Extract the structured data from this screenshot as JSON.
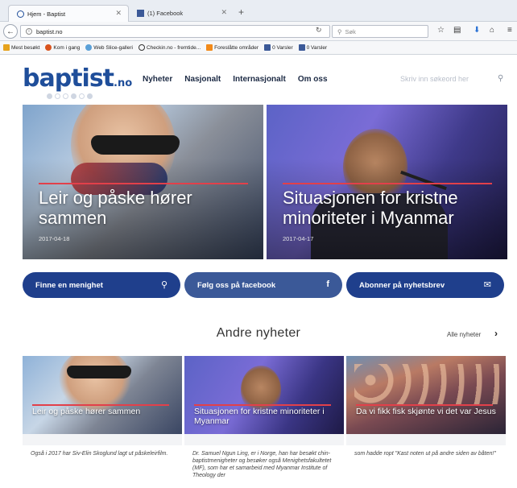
{
  "browser": {
    "tabs": [
      {
        "label": "Hjem - Baptist",
        "active": true
      },
      {
        "label": "(1) Facebook",
        "active": false
      }
    ],
    "new_tab": "+",
    "url": "baptist.no",
    "search_placeholder": "Søk",
    "bookmarks": [
      {
        "label": "Mest besøkt",
        "color": "#e6a21c"
      },
      {
        "label": "Kom i gang",
        "color": "#d9531e"
      },
      {
        "label": "Web Slice-galleri",
        "color": "#5aa0d8"
      },
      {
        "label": "Checkin.no - fremtide...",
        "color": "#333333"
      },
      {
        "label": "Foreslåtte områder",
        "color": "#f28a1a"
      },
      {
        "label": "0 Varsler",
        "color": "#3b5998"
      },
      {
        "label": "0 Varsler",
        "color": "#3b5998"
      }
    ]
  },
  "site": {
    "logo": {
      "main": "baptist",
      "suffix": ".no"
    },
    "nav": [
      "Nyheter",
      "Nasjonalt",
      "Internasjonalt",
      "Om oss"
    ],
    "search_placeholder": "Skriv inn søkeord her",
    "hero": [
      {
        "title": "Leir og påske hører sammen",
        "date": "2017-04-18"
      },
      {
        "title": "Situasjonen for kristne minoriteter i Myanmar",
        "date": "2017-04-17"
      }
    ],
    "actions": [
      {
        "label": "Finne en menighet",
        "icon": "search-icon"
      },
      {
        "label": "Følg oss på facebook",
        "icon": "facebook-icon"
      },
      {
        "label": "Abonner på nyhetsbrev",
        "icon": "mail-icon"
      }
    ],
    "section_title": "Andre nyheter",
    "all_news": "Alle nyheter",
    "cards": [
      {
        "title": "Leir og påske hører sammen",
        "body": "Også i 2017 har Siv-Elin Skoglund lagt ut påskeleirfilm."
      },
      {
        "title": "Situasjonen for kristne minoriteter i Myanmar",
        "body": "Dr. Samuel Ngun Ling, er i Norge, han har besøkt chin-baptistmenigheter og besøker også Menighetsfakultetet (MF), som har et samarbeid med Myanmar Institute of Theology der"
      },
      {
        "title": "Da vi fikk fisk skjønte vi det var Jesus",
        "body": "som hadde ropt \"Kast noten ut på andre siden av båten!\""
      }
    ],
    "colors": {
      "brand": "#1f4e9a",
      "button": "#1f3f8c",
      "accent": "#e2404a"
    }
  }
}
